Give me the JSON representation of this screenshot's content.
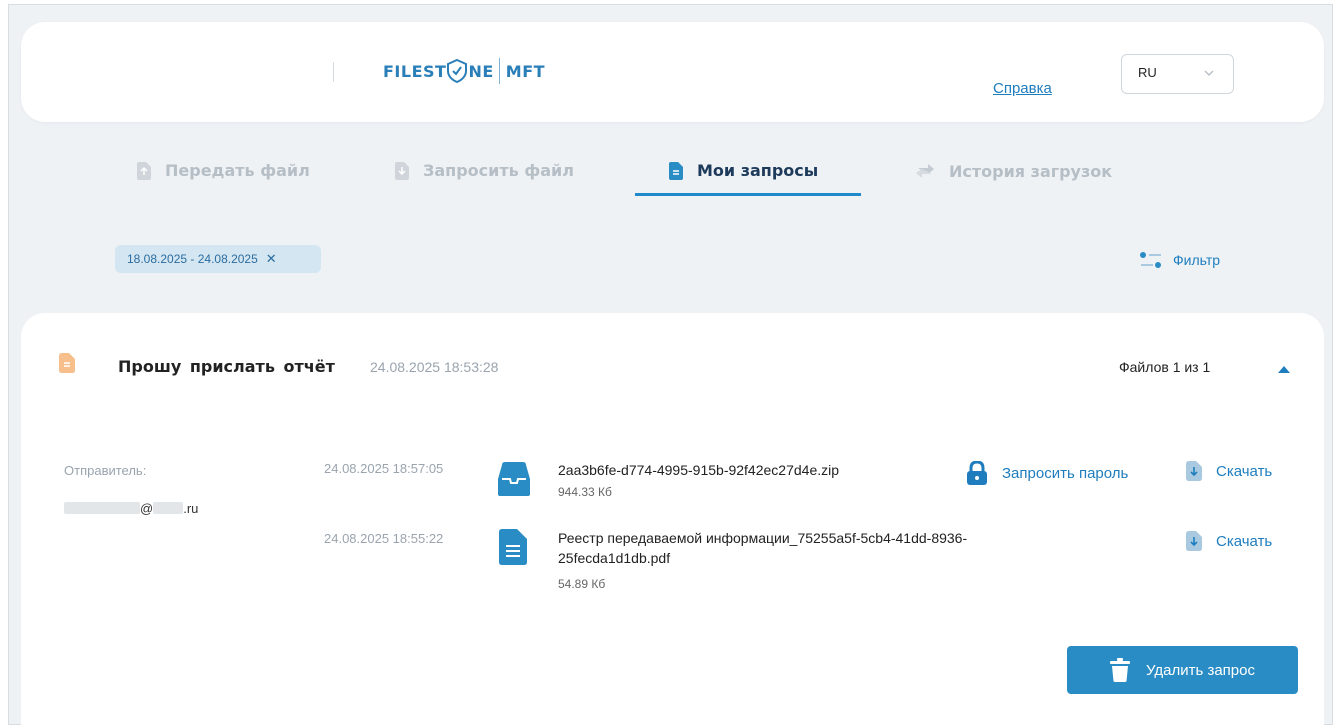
{
  "header": {
    "logo_left": "FILEST",
    "logo_mid": "NE",
    "logo_right": "MFT",
    "help_link": "Справка",
    "language": "RU"
  },
  "tabs": [
    {
      "label": "Передать файл",
      "icon": "upload-file-icon",
      "active": false
    },
    {
      "label": "Запросить файл",
      "icon": "download-file-icon",
      "active": false
    },
    {
      "label": "Мои запросы",
      "icon": "document-icon",
      "active": true
    },
    {
      "label": "История загрузок",
      "icon": "swap-arrows-icon",
      "active": false
    }
  ],
  "filters": {
    "date_range": "18.08.2025 - 24.08.2025",
    "filter_label": "Фильтр"
  },
  "request": {
    "title": "Прошу прислать отчёт",
    "date": "24.08.2025 18:53:28",
    "files_count": "Файлов 1 из 1",
    "sender_label": "Отправитель:",
    "sender_email_at": "@",
    "sender_email_domain": ".ru",
    "files": [
      {
        "time": "24.08.2025 18:57:05",
        "name": "2aa3b6fe-d774-4995-915b-92f42ec27d4e.zip",
        "size": "944.33 Кб",
        "icon": "archive-icon",
        "password_action": "Запросить пароль",
        "download_action": "Скачать"
      },
      {
        "time": "24.08.2025 18:55:22",
        "name": "Реестр передаваемой информации_75255a5f-5cb4-41dd-8936-25fecda1d1db.pdf",
        "size": "54.89 Кб",
        "icon": "document-icon",
        "download_action": "Скачать"
      }
    ],
    "delete_button": "Удалить запрос"
  },
  "colors": {
    "accent": "#2a8cc4",
    "link": "#1f7dbe",
    "background": "#eef2f5",
    "tab_inactive": "#b6bec6",
    "tab_active": "#1d3a5a"
  }
}
